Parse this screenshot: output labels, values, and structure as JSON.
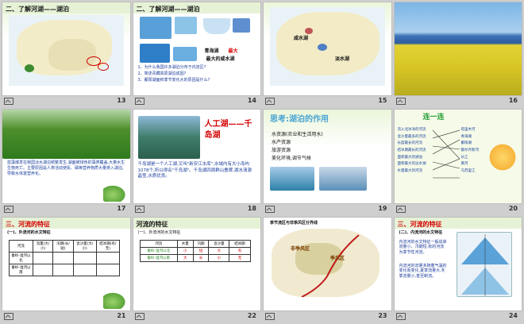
{
  "slides": [
    {
      "num": "13",
      "title": "二、了解河湖——湖泊"
    },
    {
      "num": "14",
      "title": "二、了解河湖——湖泊",
      "labels": {
        "qinghai": "青海湖",
        "max": "最大的咸水湖",
        "other": "最大"
      },
      "bullets": [
        "1、为什么我国许多湖泊分布于内流区?",
        "2、简述青藏高原湖泊成因?",
        "3、鄱阳湖面积季节变化大的原因是什么?"
      ]
    },
    {
      "num": "15",
      "labels": {
        "salt": "咸水湖",
        "fresh": "淡水湖"
      }
    },
    {
      "num": "16"
    },
    {
      "num": "17",
      "text": "蓝藻爆发在我国淡水湖泊频繁发生,湖面被绿色的藻类覆盖,大量水生生物死亡。主要原因是人类活动使氮、磷等营养物质大量排入湖泊,导致水体富营养化。"
    },
    {
      "num": "18",
      "heading": "人工湖——千岛湖",
      "text": "千岛湖是一个人工湖,又叫\"新安江水库\",水域内有大小岛屿1078个,所以得名\"千岛湖\"。千岛湖四周群山叠翠,湖水清澈晶莹,水质优良。"
    },
    {
      "num": "19",
      "heading": "思考:湖泊的作用",
      "bullets": [
        "水资源(农业和生活用水)",
        "水产资源",
        "旅游资源",
        "美化环境,调节气候"
      ]
    },
    {
      "num": "20",
      "heading": "连一连",
      "left": [
        "流入北冰洋的河流",
        "含沙量最多的河流",
        "长度最长的河流",
        "结冰期最长的河流",
        "面积最大的湖泊",
        "面积最大的淡水湖",
        "水量最大的河流"
      ],
      "right": [
        "塔里木河",
        "青海湖",
        "鄱阳湖",
        "额尔齐斯河",
        "长江",
        "黄河",
        "乌苏里江"
      ]
    },
    {
      "num": "21",
      "title": "三、河流的特征",
      "sub": "(一)、外流河的水文特征",
      "headers": [
        "河流",
        "流量(大/小)",
        "汛期(长/短)",
        "含沙量(大/小)",
        "结冰期(有/无)"
      ],
      "rows": [
        [
          "秦岭-淮河以北",
          "",
          "",
          "",
          ""
        ],
        [
          "秦岭-淮河以南",
          "",
          "",
          "",
          ""
        ]
      ]
    },
    {
      "num": "22",
      "title": "河流的特征",
      "sub": "(一)、外流河的水文特征",
      "headers": [
        "河流",
        "水量",
        "汛期",
        "含沙量",
        "结冰期"
      ],
      "rows": [
        [
          "秦岭-淮河以北",
          "小",
          "短",
          "大",
          "有"
        ],
        [
          "秦岭-淮河以南",
          "大",
          "长",
          "小",
          "无"
        ]
      ]
    },
    {
      "num": "23",
      "heading": "季节流区与非季风区分界线",
      "labels": {
        "a": "季风区",
        "b": "非季风区"
      }
    },
    {
      "num": "24",
      "title": "三、河流的特征",
      "sub": "(二)、内流河的水文特征",
      "text": "内流河的水文特征一般说来流量小、汛期短,有的河流为季节性河流。",
      "text2": "内流河的流量多随着气温的变化而变化,夏季流量大,冬季流量小,甚至断流。"
    }
  ],
  "footer_icon": "slide-icon"
}
